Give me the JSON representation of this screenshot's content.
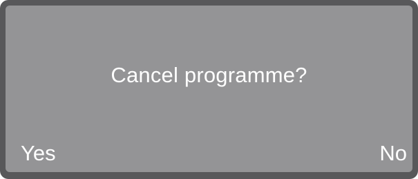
{
  "dialog": {
    "message": "Cancel programme?",
    "options": {
      "yes_label": "Yes",
      "no_label": "No"
    }
  },
  "colors": {
    "frame": "#58585a",
    "screen": "#949496",
    "text": "#ffffff"
  }
}
